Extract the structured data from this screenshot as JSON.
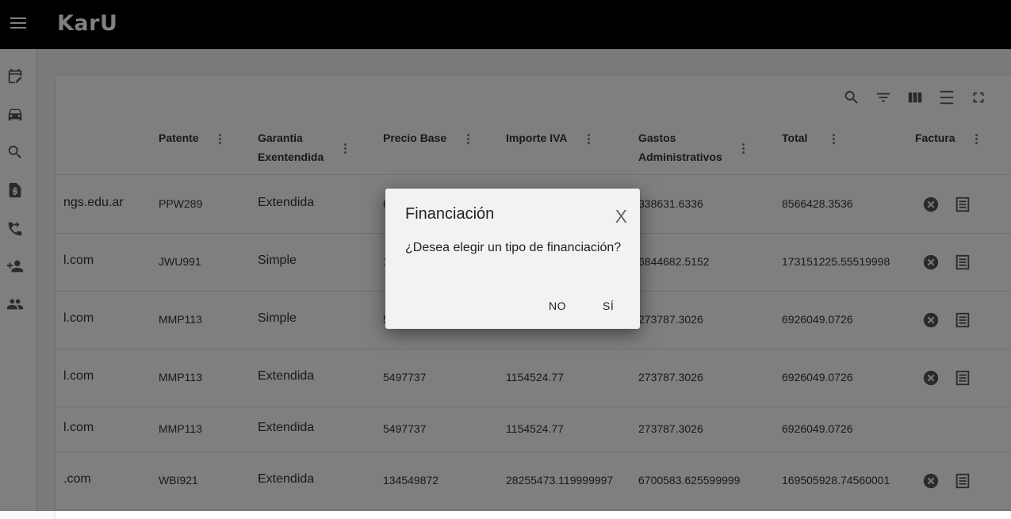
{
  "app": {
    "title": "KarU"
  },
  "sidebar": {
    "items": [
      {
        "icon": "calendar-edit-icon"
      },
      {
        "icon": "car-icon"
      },
      {
        "icon": "search-icon"
      },
      {
        "icon": "invoice-icon"
      },
      {
        "icon": "phone-forward-icon"
      },
      {
        "icon": "add-user-icon"
      },
      {
        "icon": "people-icon"
      }
    ]
  },
  "toolbar": {
    "icons": [
      "search-icon",
      "filter-icon",
      "view-column-icon",
      "density-icon",
      "fullscreen-icon"
    ]
  },
  "table": {
    "headers": {
      "patente": "Patente",
      "garantia_1": "Garantia",
      "garantia_2": "Exentendida",
      "precio_base": "Precio Base",
      "importe_iva": "Importe IVA",
      "gastos_1": "Gastos",
      "gastos_2": "Administrativos",
      "total": "Total",
      "factura": "Factura"
    },
    "rows": [
      {
        "email": "ngs.edu.ar",
        "patente": "PPW289",
        "garantia": "Extendida",
        "precio": "6",
        "iva": "",
        "gastos": "338631.6336",
        "total": "8566428.3536",
        "factura": true
      },
      {
        "email": "l.com",
        "patente": "JWU991",
        "garantia": "Simple",
        "precio": "1",
        "iva": "",
        "gastos": "6844682.5152",
        "total": "173151225.55519998",
        "factura": true
      },
      {
        "email": "l.com",
        "patente": "MMP113",
        "garantia": "Simple",
        "precio": "5",
        "iva": "",
        "gastos": "273787.3026",
        "total": "6926049.0726",
        "factura": true
      },
      {
        "email": "l.com",
        "patente": "MMP113",
        "garantia": "Extendida",
        "precio": "5497737",
        "iva": "1154524.77",
        "gastos": "273787.3026",
        "total": "6926049.0726",
        "factura": true
      },
      {
        "email": "l.com",
        "patente": "MMP113",
        "garantia": "Extendida",
        "precio": "5497737",
        "iva": "1154524.77",
        "gastos": "273787.3026",
        "total": "6926049.0726",
        "factura": false
      },
      {
        "email": ".com",
        "patente": "WBI921",
        "garantia": "Extendida",
        "precio": "134549872",
        "iva": "28255473.119999997",
        "gastos": "6700583.625599999",
        "total": "169505928.74560001",
        "factura": true
      }
    ]
  },
  "dialog": {
    "title": "Financiación",
    "close": "X",
    "message": "¿Desea elegir un tipo de financiación?",
    "no_label": "NO",
    "yes_label": "SÍ"
  }
}
